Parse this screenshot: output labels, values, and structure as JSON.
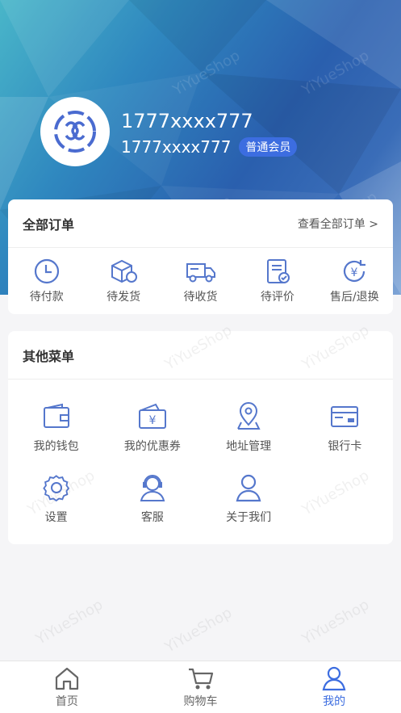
{
  "header": {
    "phone": "1777xxxx777",
    "phone_sub": "1777xxxx777",
    "member_badge": "普通会员",
    "watermark": "YiYueShop"
  },
  "orders": {
    "title": "全部订单",
    "view_all": "查看全部订单 >",
    "items": [
      {
        "label": "待付款",
        "icon": "clock-icon"
      },
      {
        "label": "待发货",
        "icon": "package-icon"
      },
      {
        "label": "待收货",
        "icon": "truck-icon"
      },
      {
        "label": "待评价",
        "icon": "review-icon"
      },
      {
        "label": "售后/退换",
        "icon": "refund-icon"
      }
    ]
  },
  "menus": {
    "title": "其他菜单",
    "items": [
      {
        "label": "我的钱包",
        "icon": "wallet-icon"
      },
      {
        "label": "我的优惠券",
        "icon": "coupon-icon"
      },
      {
        "label": "地址管理",
        "icon": "location-icon"
      },
      {
        "label": "银行卡",
        "icon": "bank-card-icon"
      },
      {
        "label": "设置",
        "icon": "gear-icon"
      },
      {
        "label": "客服",
        "icon": "support-icon"
      },
      {
        "label": "关于我们",
        "icon": "person-icon"
      }
    ]
  },
  "tabbar": {
    "items": [
      {
        "label": "首页",
        "icon": "home-icon",
        "active": false
      },
      {
        "label": "购物车",
        "icon": "cart-icon",
        "active": false
      },
      {
        "label": "我的",
        "icon": "user-icon",
        "active": true
      }
    ]
  },
  "colors": {
    "accent": "#3c6de0",
    "icon": "#5577cc"
  }
}
